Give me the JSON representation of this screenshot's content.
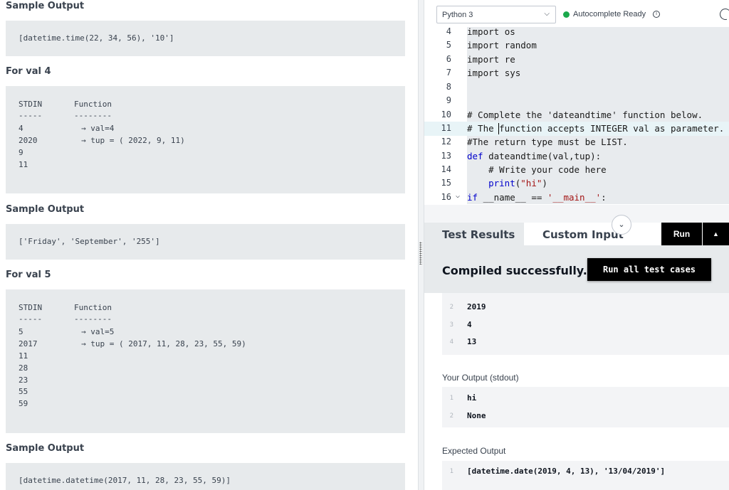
{
  "problem": {
    "sections": [
      {
        "heading": "Sample Output",
        "lines": [
          "[datetime.time(22, 34, 56), '10']"
        ]
      },
      {
        "heading": "For val 4",
        "header": [
          "STDIN",
          "Function"
        ],
        "rule": [
          "-----",
          "--------"
        ],
        "rows": [
          [
            "4",
            "→ val=4"
          ],
          [
            "2020",
            "→ tup = ( 2022, 9, 11)"
          ],
          [
            "9",
            ""
          ],
          [
            "11",
            ""
          ]
        ]
      },
      {
        "heading": "Sample Output",
        "lines": [
          "['Friday', 'September', '255']"
        ]
      },
      {
        "heading": "For val 5",
        "header": [
          "STDIN",
          "Function"
        ],
        "rule": [
          "-----",
          "--------"
        ],
        "rows": [
          [
            "5",
            "→ val=5"
          ],
          [
            "2017",
            "→ tup = ( 2017, 11, 28, 23, 55, 59)"
          ],
          [
            "11",
            ""
          ],
          [
            "28",
            ""
          ],
          [
            "23",
            ""
          ],
          [
            "55",
            ""
          ],
          [
            "59",
            ""
          ]
        ]
      },
      {
        "heading": "Sample Output",
        "lines": [
          "[datetime.datetime(2017, 11, 28, 23, 55, 59)]"
        ]
      }
    ]
  },
  "toolbar": {
    "language": "Python 3",
    "status": "Autocomplete Ready",
    "status_color": "#1ba94c",
    "info_icon": "ⓘ"
  },
  "editor": {
    "lines": [
      {
        "num": "4",
        "code": "import os"
      },
      {
        "num": "5",
        "code": "import random"
      },
      {
        "num": "6",
        "code": "import re"
      },
      {
        "num": "7",
        "code": "import sys"
      },
      {
        "num": "8",
        "code": ""
      },
      {
        "num": "9",
        "code": ""
      },
      {
        "num": "10",
        "code": "# Complete the 'dateandtime' function below."
      },
      {
        "num": "11",
        "code": "# The function accepts INTEGER val as parameter."
      },
      {
        "num": "12",
        "code": "#The return type must be LIST."
      },
      {
        "num": "13",
        "code": "def dateandtime(val,tup):"
      },
      {
        "num": "14",
        "code": "    # Write your code here"
      },
      {
        "num": "15",
        "code": "    print(\"hi\")"
      },
      {
        "num": "16",
        "code": "if __name__ == '__main__':"
      }
    ]
  },
  "tabs": {
    "test_results": "Test Results",
    "custom_input": "Custom Input",
    "run": "Run",
    "run_caret": "▲",
    "collapse": "⌄"
  },
  "results": {
    "status": "Compiled successfully.",
    "run_all": "Run all test cases",
    "input_lines": [
      {
        "n": "2",
        "v": "2019"
      },
      {
        "n": "3",
        "v": "4"
      },
      {
        "n": "4",
        "v": "13"
      }
    ],
    "stdout_label": "Your Output (stdout)",
    "stdout_lines": [
      {
        "n": "1",
        "v": "hi"
      },
      {
        "n": "2",
        "v": "None"
      }
    ],
    "expected_label": "Expected Output",
    "expected_lines": [
      {
        "n": "1",
        "v": "[datetime.date(2019, 4, 13), '13/04/2019']"
      }
    ]
  }
}
